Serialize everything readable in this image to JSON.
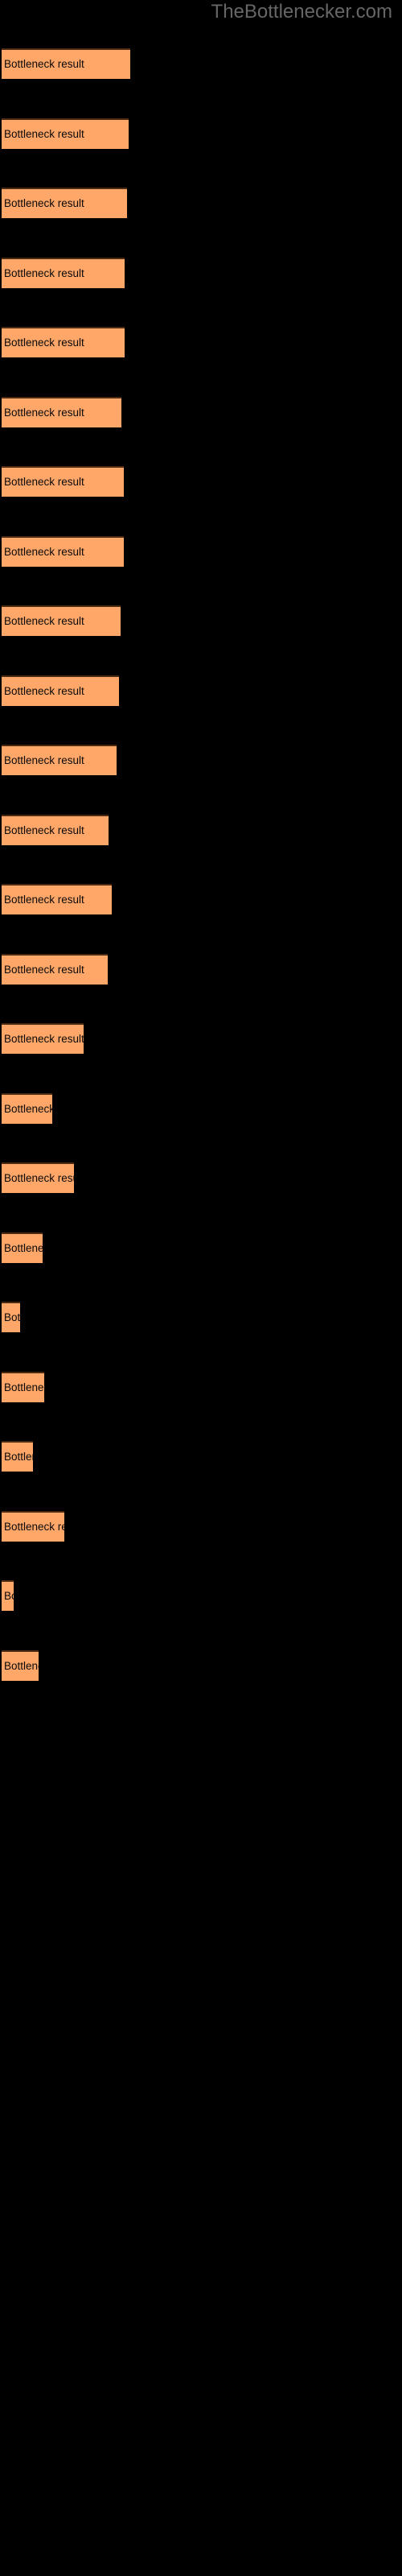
{
  "header": {
    "site_title": "TheBottlenecker.com"
  },
  "colors": {
    "background": "#000000",
    "bar_fill": "#ffa768",
    "bar_border_top": "#4a2a12",
    "label_text": "#0a0a0a",
    "title_text": "#666666"
  },
  "chart_data": {
    "type": "bar",
    "orientation": "horizontal",
    "title": "TheBottlenecker.com",
    "xlabel": "",
    "ylabel": "",
    "grid": false,
    "legend": "none",
    "axis_visible": false,
    "bar_label_text": "Bottleneck result",
    "categories": [
      "Bottleneck result",
      "Bottleneck result",
      "Bottleneck result",
      "Bottleneck result",
      "Bottleneck result",
      "Bottleneck result",
      "Bottleneck result",
      "Bottleneck result",
      "Bottleneck result",
      "Bottleneck result",
      "Bottleneck result",
      "Bottleneck result",
      "Bottleneck result",
      "Bottleneck result",
      "Bottleneck result",
      "Bottleneck result",
      "Bottleneck result",
      "Bottleneck result",
      "Bottleneck result",
      "Bottleneck result",
      "Bottleneck result",
      "Bottleneck result",
      "Bottleneck result",
      "Bottleneck result"
    ],
    "values": [
      160,
      158,
      156,
      153,
      153,
      149,
      152,
      152,
      148,
      146,
      143,
      133,
      137,
      132,
      102,
      63,
      90,
      51,
      23,
      53,
      39,
      78,
      15,
      46
    ],
    "xlim": [
      0,
      500
    ],
    "bars": [
      {
        "index": 1,
        "label": "Bottleneck result",
        "width": 160,
        "top": 60
      },
      {
        "index": 2,
        "label": "Bottleneck result",
        "width": 158,
        "top": 147
      },
      {
        "index": 3,
        "label": "Bottleneck result",
        "width": 156,
        "top": 233
      },
      {
        "index": 4,
        "label": "Bottleneck result",
        "width": 153,
        "top": 320
      },
      {
        "index": 5,
        "label": "Bottleneck result",
        "width": 153,
        "top": 406
      },
      {
        "index": 6,
        "label": "Bottleneck result",
        "width": 149,
        "top": 493
      },
      {
        "index": 7,
        "label": "Bottleneck result",
        "width": 152,
        "top": 579
      },
      {
        "index": 8,
        "label": "Bottleneck result",
        "width": 152,
        "top": 666
      },
      {
        "index": 9,
        "label": "Bottleneck result",
        "width": 148,
        "top": 752
      },
      {
        "index": 10,
        "label": "Bottleneck result",
        "width": 146,
        "top": 839
      },
      {
        "index": 11,
        "label": "Bottleneck result",
        "width": 143,
        "top": 925
      },
      {
        "index": 12,
        "label": "Bottleneck result",
        "width": 133,
        "top": 1012
      },
      {
        "index": 13,
        "label": "Bottleneck result",
        "width": 137,
        "top": 1098
      },
      {
        "index": 14,
        "label": "Bottleneck result",
        "width": 132,
        "top": 1185
      },
      {
        "index": 15,
        "label": "Bottleneck result",
        "width": 102,
        "top": 1271
      },
      {
        "index": 16,
        "label": "Bottleneck result",
        "width": 63,
        "top": 1358
      },
      {
        "index": 17,
        "label": "Bottleneck result",
        "width": 90,
        "top": 1444
      },
      {
        "index": 18,
        "label": "Bottleneck result",
        "width": 51,
        "top": 1531
      },
      {
        "index": 19,
        "label": "Bottleneck result",
        "width": 23,
        "top": 1617
      },
      {
        "index": 20,
        "label": "Bottleneck result",
        "width": 53,
        "top": 1704
      },
      {
        "index": 21,
        "label": "Bottleneck result",
        "width": 39,
        "top": 1790
      },
      {
        "index": 22,
        "label": "Bottleneck result",
        "width": 78,
        "top": 1877
      },
      {
        "index": 23,
        "label": "Bottleneck result",
        "width": 15,
        "top": 1963
      },
      {
        "index": 24,
        "label": "Bottleneck result",
        "width": 46,
        "top": 2050
      }
    ]
  }
}
